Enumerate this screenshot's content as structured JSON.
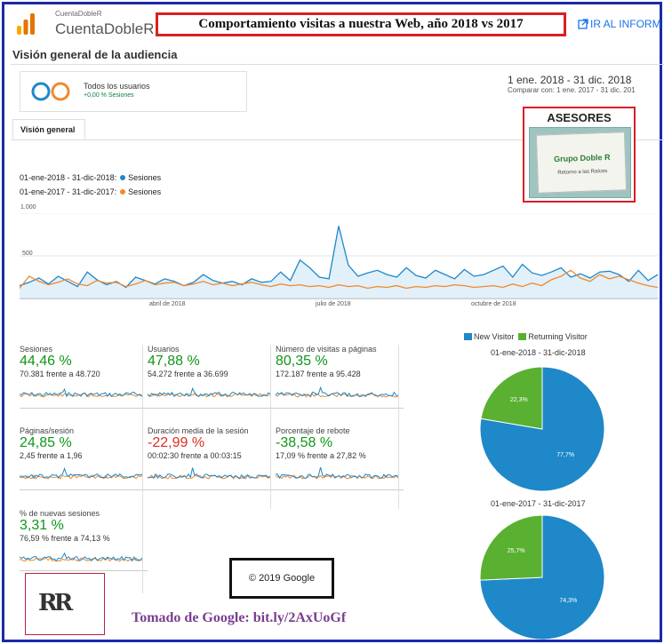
{
  "header": {
    "account_small": "CuentaDobleR",
    "account_name": "CuentaDobleR",
    "banner_title": "Comportamiento visitas a nuestra Web, año 2018 vs 2017",
    "report_link": "IR AL INFORM"
  },
  "page_title": "Visión general de la audiencia",
  "segment": {
    "label": "Todos los usuarios",
    "sub": "+0,00 % Sesiones"
  },
  "dates": {
    "range": "1 ene. 2018 - 31 dic. 2018",
    "compare": "Comparar con: 1 ene. 2017 - 31 dic. 201"
  },
  "tab": "Visión general",
  "asesores": {
    "title": "ASESORES",
    "sign_line1": "Grupo Doble R",
    "sign_line2": "Retorno a las Raíces"
  },
  "colors": {
    "blue": "#1e88c9",
    "orange": "#f0892d",
    "green": "#5ab031",
    "accent": "#1a73e8",
    "red_border": "#d81f26"
  },
  "chart_data": [
    {
      "type": "line",
      "legend": [
        {
          "range": "01-ene-2018 - 31-dic-2018:",
          "name": "Sesiones",
          "color": "#1e88c9"
        },
        {
          "range": "01-ene-2017 - 31-dic-2017:",
          "name": "Sesiones",
          "color": "#f0892d"
        }
      ],
      "y_ticks": [
        "1.000",
        "500"
      ],
      "x_ticks": [
        "abril de 2018",
        "julio de 2018",
        "octubre de 2018"
      ],
      "ylim": [
        0,
        1000
      ],
      "series": [
        {
          "name": "Sesiones",
          "values": [
            150,
            190,
            240,
            170,
            260,
            200,
            140,
            310,
            220,
            160,
            200,
            130,
            250,
            210,
            170,
            230,
            200,
            150,
            190,
            280,
            210,
            180,
            200,
            160,
            230,
            190,
            200,
            310,
            210,
            450,
            360,
            250,
            230,
            850,
            390,
            260,
            300,
            330,
            280,
            250,
            360,
            270,
            240,
            330,
            280,
            230,
            340,
            260,
            280,
            330,
            380,
            250,
            400,
            300,
            270,
            310,
            360,
            250,
            290,
            240,
            310,
            320,
            280,
            200,
            330,
            210,
            280
          ]
        },
        {
          "name": "Sesiones",
          "values": [
            120,
            260,
            200,
            160,
            190,
            230,
            170,
            150,
            210,
            180,
            190,
            140,
            170,
            210,
            160,
            180,
            190,
            150,
            170,
            200,
            160,
            180,
            150,
            170,
            190,
            160,
            140,
            170,
            150,
            160,
            140,
            150,
            130,
            160,
            140,
            150,
            120,
            140,
            130,
            150,
            120,
            140,
            130,
            150,
            140,
            160,
            150,
            130,
            140,
            150,
            130,
            170,
            140,
            180,
            150,
            220,
            260,
            330,
            240,
            200,
            280,
            230,
            260,
            220,
            180,
            150,
            130
          ]
        }
      ]
    },
    {
      "type": "pie",
      "title": "01-ene-2018 - 31-dic-2018",
      "categories": [
        "New Visitor",
        "Returning Visitor"
      ],
      "values": [
        77.7,
        22.3
      ],
      "labels": [
        "77,7%",
        "22,3%"
      ]
    },
    {
      "type": "pie",
      "title": "01-ene-2017 - 31-dic-2017",
      "categories": [
        "New Visitor",
        "Returning Visitor"
      ],
      "values": [
        74.3,
        25.7
      ],
      "labels": [
        "74,3%",
        "25,7%"
      ]
    }
  ],
  "metrics": [
    {
      "title": "Sesiones",
      "value": "44,46 %",
      "sub": "70.381 frente a 48.720",
      "trend": "up"
    },
    {
      "title": "Usuarios",
      "value": "47,88 %",
      "sub": "54.272 frente a 36.699",
      "trend": "up"
    },
    {
      "title": "Número de visitas a páginas",
      "value": "80,35 %",
      "sub": "172.187 frente a 95.428",
      "trend": "up"
    },
    {
      "title": "Páginas/sesión",
      "value": "24,85 %",
      "sub": "2,45 frente a 1,96",
      "trend": "up"
    },
    {
      "title": "Duración media de la sesión",
      "value": "-22,99 %",
      "sub": "00:02:30 frente a 00:03:15",
      "trend": "down"
    },
    {
      "title": "Porcentaje de rebote",
      "value": "-38,58 %",
      "sub": "17,09 % frente a 27,82 %",
      "trend": "up"
    },
    {
      "title": "% de nuevas sesiones",
      "value": "3,31 %",
      "sub": "76,59 % frente a 74,13 %",
      "trend": "up"
    }
  ],
  "pie_legend": [
    "New Visitor",
    "Returning Visitor"
  ],
  "footer": {
    "copyright": "© 2019 Google",
    "credit": "Tomado de Google: bit.ly/2AxUoGf",
    "logo_text": "RR"
  }
}
